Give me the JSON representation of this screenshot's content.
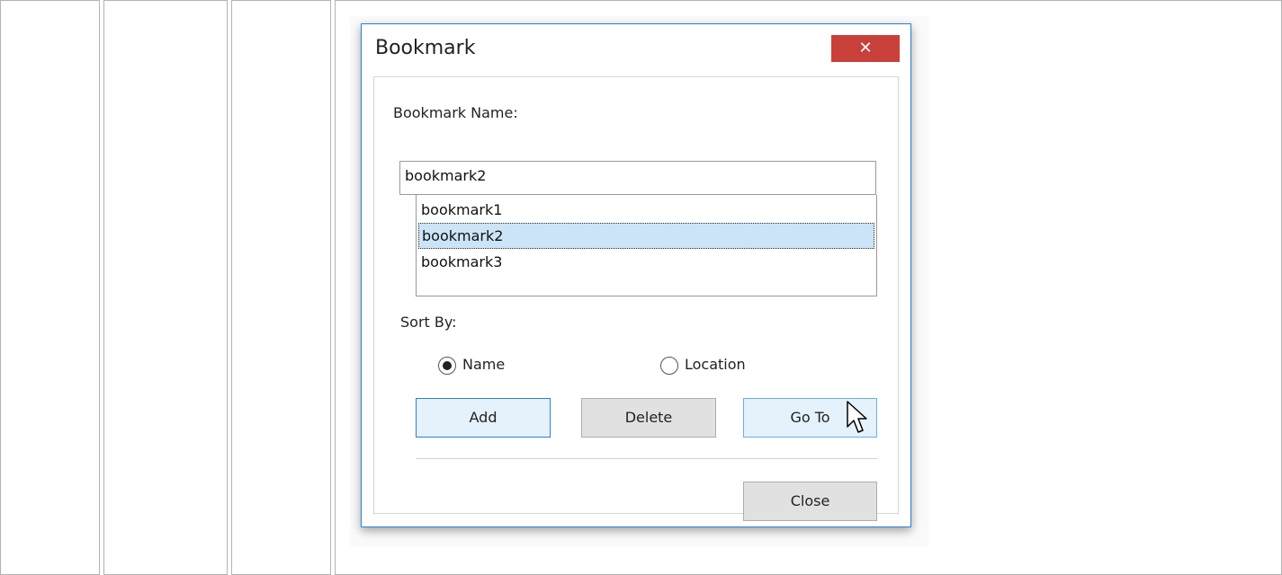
{
  "dialog": {
    "title": "Bookmark",
    "close_glyph": "✕",
    "bookmark_name_label": "Bookmark Name:",
    "bookmark_name_value": "bookmark2",
    "bookmarks": [
      "bookmark1",
      "bookmark2",
      "bookmark3"
    ],
    "selected_index": 1,
    "sort_by_label": "Sort By:",
    "sort_options": [
      {
        "label": "Name",
        "checked": true
      },
      {
        "label": "Location",
        "checked": false
      }
    ],
    "buttons": {
      "add": "Add",
      "delete": "Delete",
      "goto": "Go To",
      "close": "Close"
    },
    "colors": {
      "accent": "#2b7fd6",
      "close_bg": "#c9403a",
      "selection": "#cce4f7"
    },
    "cursor_icon": "arrow-pointer-icon"
  }
}
